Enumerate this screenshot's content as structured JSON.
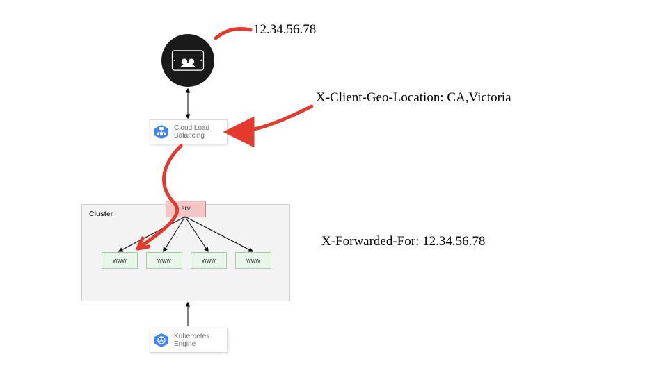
{
  "annotations": {
    "ip": "12.34.56.78",
    "header_geo": "X-Client-Geo-Location: CA,Victoria",
    "header_xff": "X-Forwarded-For: 12.34.56.78"
  },
  "services": {
    "lb": {
      "label1": "Cloud Load",
      "label2": "Balancing"
    },
    "k8s": {
      "label1": "Kubernetes",
      "label2": "Engine"
    }
  },
  "cluster": {
    "label": "Cluster",
    "service": "srv",
    "pods": [
      "www",
      "www",
      "www",
      "www"
    ]
  },
  "colors": {
    "red": "#e43a2e",
    "gcp_blue": "#4285f4"
  }
}
